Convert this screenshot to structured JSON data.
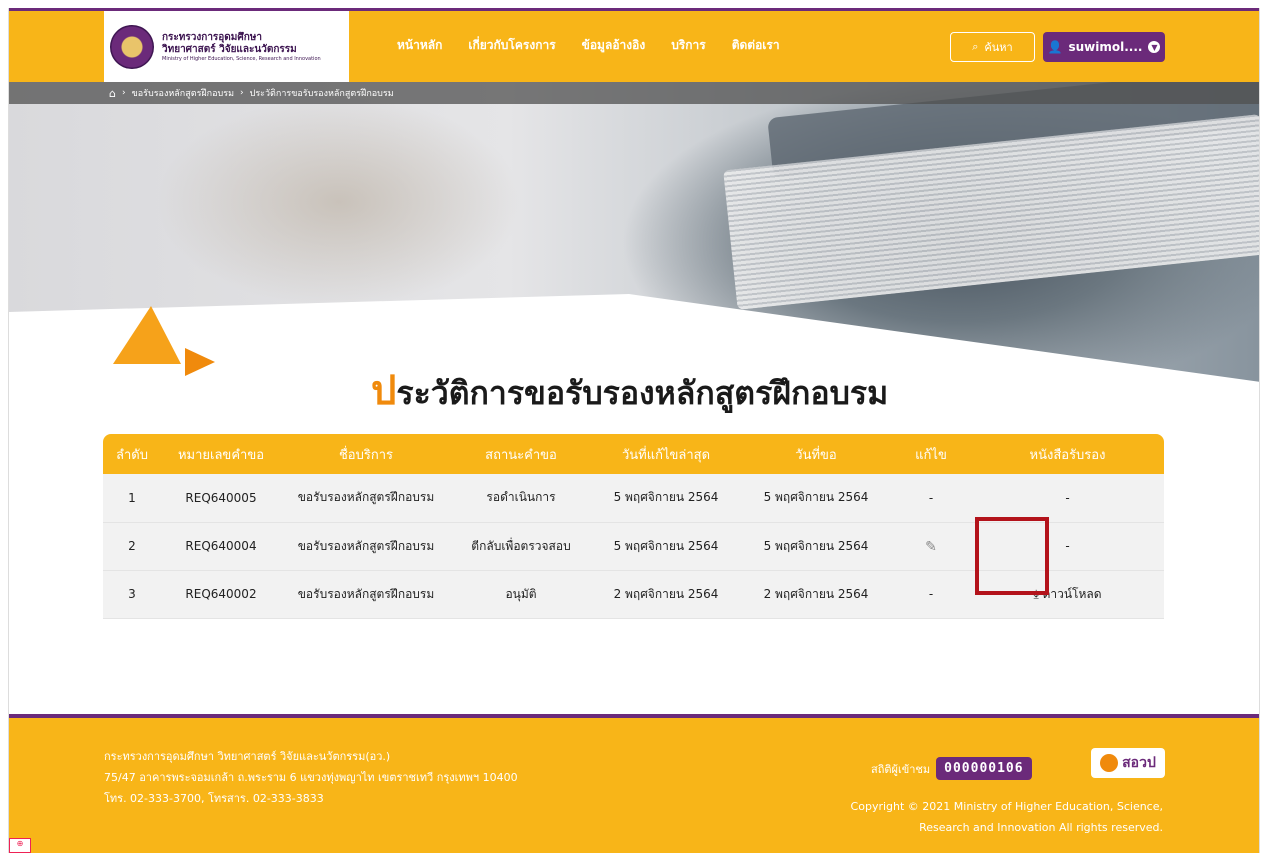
{
  "header": {
    "logo_line1": "กระทรวงการอุดมศึกษา",
    "logo_line2": "วิทยาศาสตร์ วิจัยและนวัตกรรม",
    "logo_line3": "Ministry of Higher Education, Science, Research and Innovation",
    "nav": [
      "หน้าหลัก",
      "เกี่ยวกับโครงการ",
      "ข้อมูลอ้างอิง",
      "บริการ",
      "ติดต่อเรา"
    ],
    "search_label": "ค้นหา",
    "user_label": "suwimol...."
  },
  "breadcrumb": {
    "item1": "ขอรับรองหลักสูตรฝึกอบรม",
    "item2": "ประวัติการขอรับรองหลักสูตรฝึกอบรม"
  },
  "page": {
    "title_first": "ป",
    "title_rest": "ระวัติการขอรับรองหลักสูตรฝึกอบรม"
  },
  "table": {
    "headers": [
      "ลำดับ",
      "หมายเลขคำขอ",
      "ชื่อบริการ",
      "สถานะคำขอ",
      "วันที่แก้ไขล่าสุด",
      "วันที่ขอ",
      "แก้ไข",
      "หนังสือรับรอง"
    ],
    "rows": [
      {
        "no": "1",
        "request": "REQ640005",
        "service": "ขอรับรองหลักสูตรฝึกอบรม",
        "status": "รอดำเนินการ",
        "updated": "5 พฤศจิกายน 2564",
        "requested": "5 พฤศจิกายน 2564",
        "edit": "-",
        "cert": "-"
      },
      {
        "no": "2",
        "request": "REQ640004",
        "service": "ขอรับรองหลักสูตรฝึกอบรม",
        "status": "ตีกลับเพื่อตรวจสอบ",
        "updated": "5 พฤศจิกายน 2564",
        "requested": "5 พฤศจิกายน 2564",
        "edit": "pencil-icon",
        "cert": "-"
      },
      {
        "no": "3",
        "request": "REQ640002",
        "service": "ขอรับรองหลักสูตรฝึกอบรม",
        "status": "อนุมัติ",
        "updated": "2 พฤศจิกายน 2564",
        "requested": "2 พฤศจิกายน 2564",
        "edit": "-",
        "cert": "ดาวน์โหลด"
      }
    ]
  },
  "footer": {
    "addr1": "กระทรวงการอุดมศึกษา วิทยาศาสตร์ วิจัยและนวัตกรรม(อว.)",
    "addr2": "75/47 อาคารพระจอมเกล้า ถ.พระราม 6 แขวงทุ่งพญาไท เขตราชเทวี กรุงเทพฯ 10400",
    "addr3": "โทร. 02-333-3700, โทรสาร. 02-333-3833",
    "stat_label": "สถิติผู้เข้าชม",
    "counter": "000000106",
    "brand": "สอวป",
    "copy1": "Copyright © 2021 Ministry of Higher Education, Science,",
    "copy2": "Research and Innovation All rights reserved."
  },
  "colors": {
    "primary": "#f8b518",
    "purple": "#6b2a7a",
    "accent": "#f08a0c",
    "highlight": "#b3131b"
  }
}
